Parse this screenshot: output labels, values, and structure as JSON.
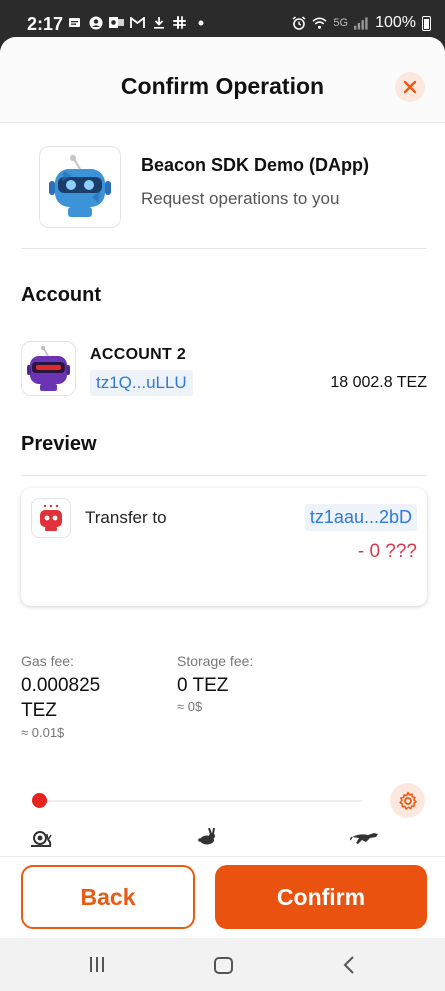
{
  "status_bar": {
    "time": "2:17",
    "network": "5G",
    "battery": "100%"
  },
  "sheet": {
    "title": "Confirm Operation",
    "close_icon": "close-icon"
  },
  "dapp": {
    "name": "Beacon SDK Demo (DApp)",
    "subtitle": "Request operations to you",
    "icon": "robot-avatar-icon"
  },
  "account": {
    "section_title": "Account",
    "name": "ACCOUNT 2",
    "address": "tz1Q...uLLU",
    "balance": "18 002.8 TEZ"
  },
  "preview": {
    "section_title": "Preview",
    "transfer_label": "Transfer to",
    "recipient": "tz1aau...2bD",
    "amount": "- 0 ???"
  },
  "fees": {
    "gas_label": "Gas fee:",
    "gas_value_line1": "0.000825",
    "gas_value_line2": "TEZ",
    "gas_approx": "≈ 0.01$",
    "storage_label": "Storage fee:",
    "storage_value": "0 TEZ",
    "storage_approx": "≈ 0$"
  },
  "fee_speed": {
    "icons": [
      "snail-icon",
      "rabbit-icon",
      "cheetah-icon"
    ],
    "selected_index": 0
  },
  "actions": {
    "back_label": "Back",
    "confirm_label": "Confirm"
  },
  "colors": {
    "accent": "#ea5a12",
    "link": "#2f7ad6",
    "negative": "#d9384a"
  }
}
